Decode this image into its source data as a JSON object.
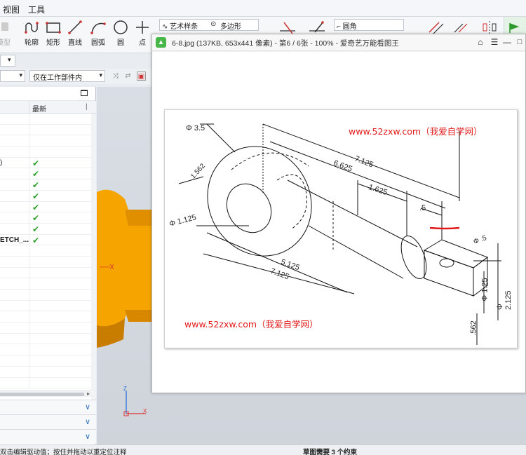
{
  "menubar": {
    "items": [
      "视图",
      "工具"
    ]
  },
  "ribbon": {
    "tools": [
      "模型",
      "轮廓",
      "矩形",
      "直线",
      "圆弧",
      "圆",
      "点"
    ],
    "combos": [
      "艺术样条",
      "多边形",
      "圆角"
    ]
  },
  "filter": {
    "combo": "仅在工作部件内"
  },
  "navigator": {
    "column_latest": "最新",
    "rows": [
      {
        "name": "",
        "check": false
      },
      {
        "name": "",
        "check": false
      },
      {
        "name": "",
        "check": false
      },
      {
        "name": "",
        "check": false
      },
      {
        "name": ")",
        "check": true
      },
      {
        "name": "",
        "check": true
      },
      {
        "name": "",
        "check": true
      },
      {
        "name": "",
        "check": true
      },
      {
        "name": "",
        "check": true
      },
      {
        "name": "",
        "check": true
      },
      {
        "name": "",
        "check": true
      },
      {
        "name": "ETCH_...",
        "check": true
      },
      {
        "name": "",
        "check": false
      },
      {
        "name": "",
        "check": false
      },
      {
        "name": "",
        "check": false
      },
      {
        "name": "",
        "check": false
      },
      {
        "name": "",
        "check": false
      },
      {
        "name": "",
        "check": false
      },
      {
        "name": "",
        "check": false
      },
      {
        "name": "",
        "check": false
      },
      {
        "name": "",
        "check": false
      },
      {
        "name": "",
        "check": false
      },
      {
        "name": "",
        "check": false
      },
      {
        "name": "",
        "check": false
      },
      {
        "name": "",
        "check": false
      }
    ]
  },
  "viewer": {
    "title": "6-8.jpg (137KB, 653x441 像素) - 第6 / 6张 - 100% - 爱奇艺万能看图王",
    "watermark": "www.52zxw.com（我爱自学网）",
    "dims": {
      "phi35": "Φ 3.5",
      "d7125": "7.125",
      "d6625": "6.625",
      "d1562": "1.562",
      "d1625": "1.625",
      "d05": ".5",
      "phi1125": "Φ 1.125",
      "phi05": "Φ .5",
      "d5125": "5.125",
      "d7125b": "7.125",
      "phi125": "Φ 1.25",
      "phi2125": "Φ 2.125",
      "d0562": ".562"
    }
  },
  "axis": {
    "x": "X",
    "z": "Z"
  },
  "status": {
    "left": "双击编辑驱动值；按住并拖动以重定位注释",
    "right": "草图需要 3 个约束"
  }
}
